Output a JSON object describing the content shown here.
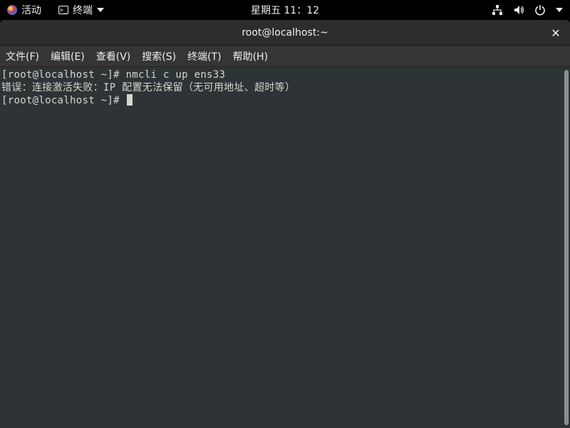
{
  "topbar": {
    "activities_label": "活动",
    "app_label": "终端",
    "clock": "星期五 11：12",
    "icons": [
      "network-icon",
      "volume-icon",
      "power-icon",
      "system-menu-caret-icon"
    ]
  },
  "window": {
    "title": "root@localhost:~",
    "close_label": "✕"
  },
  "menubar": {
    "items": [
      {
        "label": "文件(F)"
      },
      {
        "label": "编辑(E)"
      },
      {
        "label": "查看(V)"
      },
      {
        "label": "搜索(S)"
      },
      {
        "label": "终端(T)"
      },
      {
        "label": "帮助(H)"
      }
    ]
  },
  "terminal": {
    "lines": [
      "[root@localhost ~]# nmcli c up ens33",
      "错误：连接激活失败：IP 配置无法保留（无可用地址、超时等）",
      "[root@localhost ~]# "
    ]
  },
  "colors": {
    "topbar_bg": "#000000",
    "titlebar_bg": "#2d2d2d",
    "menubar_bg": "#353535",
    "terminal_bg": "#2e3436",
    "terminal_fg": "#d3d7cf"
  }
}
